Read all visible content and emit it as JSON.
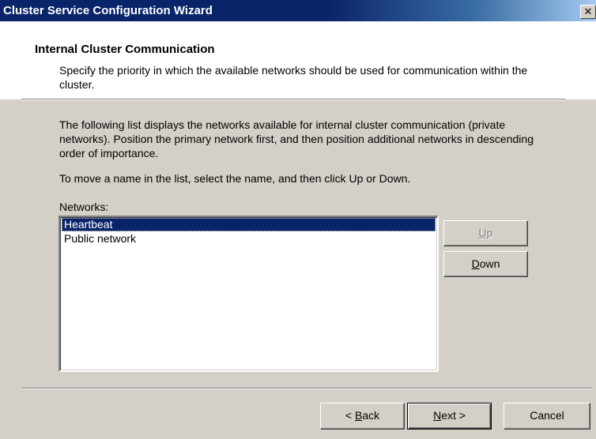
{
  "window": {
    "title": "Cluster Service Configuration Wizard",
    "close_glyph": "✕"
  },
  "header": {
    "title": "Internal Cluster Communication",
    "subtitle": "Specify the priority in which the available networks should be used for communication within the cluster."
  },
  "body": {
    "description": "The following list displays the networks available for internal cluster communication (private networks). Position the primary network first, and then position additional networks in descending order of importance.",
    "instruction": "To move a name in the list, select the name, and then click Up or Down.",
    "networks_label": "Networks:",
    "networks": [
      {
        "label": "Heartbeat",
        "selected": true
      },
      {
        "label": "Public network",
        "selected": false
      }
    ]
  },
  "buttons": {
    "up": {
      "label": "Up",
      "mnemonic": "U",
      "rest": "p",
      "enabled": false
    },
    "down": {
      "label": "Down",
      "mnemonic": "D",
      "rest": "own",
      "enabled": true
    },
    "back": {
      "label": "< Back",
      "prefix": "< ",
      "mnemonic": "B",
      "rest": "ack"
    },
    "next": {
      "label": "Next >",
      "mnemonic": "N",
      "rest": "ext >"
    },
    "cancel": {
      "label": "Cancel"
    }
  },
  "colors": {
    "titlebar": "#0a246a",
    "selection": "#0a246a",
    "face": "#d4d0c8"
  }
}
